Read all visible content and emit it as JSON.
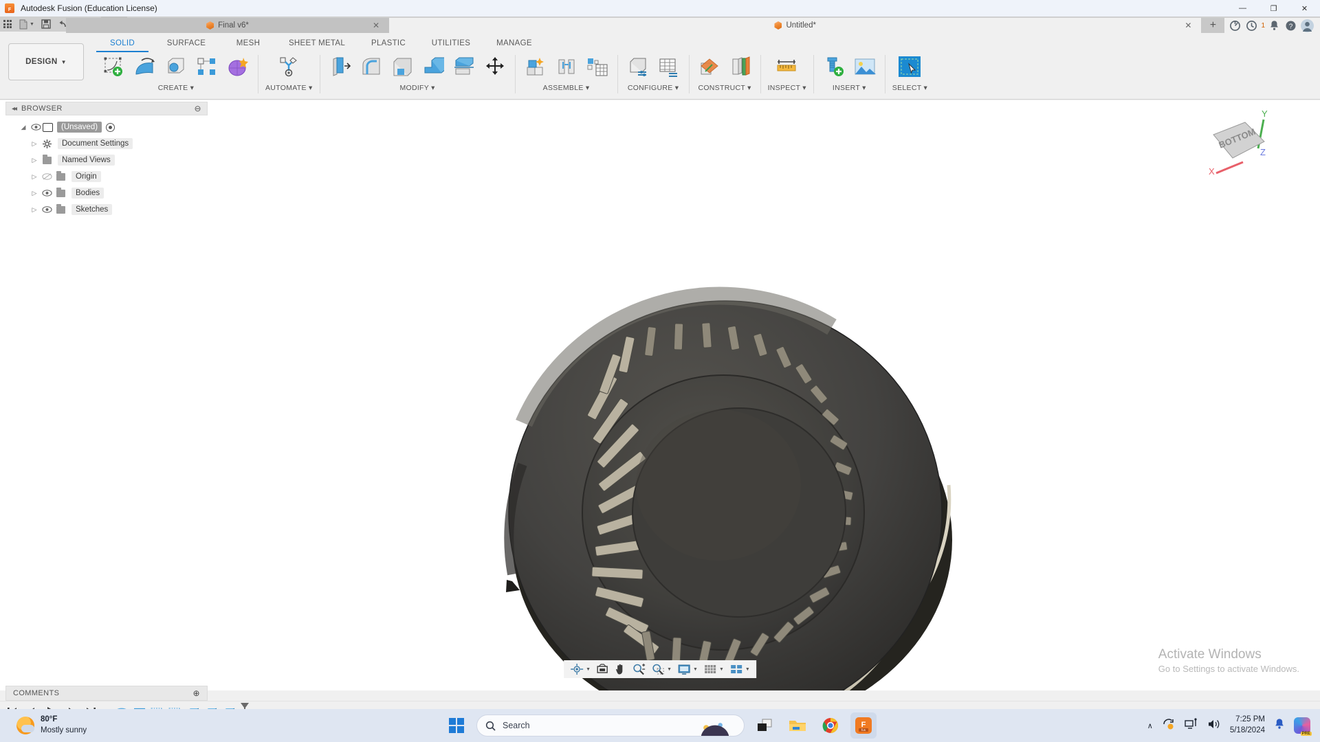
{
  "window": {
    "title": "Autodesk Fusion (Education License)",
    "app_icon": "fusion-logo-icon",
    "minimize": "—",
    "maximize": "❐",
    "close": "✕"
  },
  "quick_access": {
    "items": [
      {
        "name": "app-grid-button",
        "icon": "grid-icon",
        "caret": false
      },
      {
        "name": "new-document-button",
        "icon": "file-icon",
        "caret": true
      },
      {
        "name": "save-button",
        "icon": "save-icon",
        "caret": false
      },
      {
        "name": "undo-button",
        "icon": "undo-arrow-icon",
        "caret": true
      },
      {
        "name": "redo-button",
        "icon": "redo-arrow-icon",
        "caret": true
      },
      {
        "name": "home-button",
        "icon": "home-icon",
        "caret": false
      }
    ]
  },
  "tabs": {
    "documents": [
      {
        "label": "Final v6*",
        "active": true,
        "closable": true
      },
      {
        "label": "Untitled*",
        "active": false,
        "closable": true
      }
    ],
    "close_glyph": "✕",
    "new_tab_glyph": "+",
    "actions": [
      {
        "name": "extensions-icon",
        "label": ""
      },
      {
        "name": "job-status-icon",
        "label": "1"
      },
      {
        "name": "notifications-bell-icon",
        "label": ""
      },
      {
        "name": "help-question-icon",
        "label": ""
      },
      {
        "name": "user-avatar",
        "label": ""
      }
    ],
    "job_count": "1"
  },
  "ribbon": {
    "workspace": "DESIGN",
    "workspace_caret": "▾",
    "tabs": [
      {
        "label": "SOLID",
        "active": true
      },
      {
        "label": "SURFACE",
        "active": false
      },
      {
        "label": "MESH",
        "active": false
      },
      {
        "label": "SHEET METAL",
        "active": false
      },
      {
        "label": "PLASTIC",
        "active": false
      },
      {
        "label": "UTILITIES",
        "active": false
      },
      {
        "label": "MANAGE",
        "active": false
      }
    ],
    "panels": [
      {
        "label": "CREATE ▾",
        "tools": [
          "new-sketch-icon",
          "revolve-icon",
          "loft-icon",
          "pattern-icon",
          "form-icon"
        ]
      },
      {
        "label": "AUTOMATE ▾",
        "tools": [
          "automate-icon"
        ]
      },
      {
        "label": "MODIFY ▾",
        "tools": [
          "press-pull-icon",
          "fillet-icon",
          "shell-icon",
          "combine-icon",
          "split-body-icon",
          "move-copy-icon"
        ]
      },
      {
        "label": "ASSEMBLE ▾",
        "tools": [
          "new-component-icon",
          "joint-icon",
          "assemble-table-icon"
        ]
      },
      {
        "label": "CONFIGURE ▾",
        "tools": [
          "configure-component-icon",
          "configure-table-icon"
        ]
      },
      {
        "label": "CONSTRUCT ▾",
        "tools": [
          "offset-plane-icon",
          "plane-at-angle-icon"
        ]
      },
      {
        "label": "INSPECT ▾",
        "tools": [
          "measure-icon"
        ]
      },
      {
        "label": "INSERT ▾",
        "tools": [
          "insert-mcmaster-icon",
          "insert-canvas-icon"
        ]
      },
      {
        "label": "SELECT ▾",
        "tools": [
          "select-window-icon"
        ]
      }
    ]
  },
  "browser": {
    "title": "BROWSER",
    "collapse_glyph": "◂◂",
    "minimize_glyph": "⊖",
    "nodes": [
      {
        "label": "(Unsaved)",
        "icon": "document-cube-icon",
        "visibility": "eye-visible-icon",
        "selected": true,
        "expander": "expanded-arrow",
        "has_radio": true
      },
      {
        "label": "Document Settings",
        "icon": "gear-icon",
        "visibility": "none",
        "selected": false,
        "expander": "collapsed-arrow",
        "has_radio": false
      },
      {
        "label": "Named Views",
        "icon": "folder-icon",
        "visibility": "none",
        "selected": false,
        "expander": "collapsed-arrow",
        "has_radio": false
      },
      {
        "label": "Origin",
        "icon": "folder-icon",
        "visibility": "eye-hidden-icon",
        "selected": false,
        "expander": "collapsed-arrow",
        "has_radio": false
      },
      {
        "label": "Bodies",
        "icon": "folder-icon",
        "visibility": "eye-visible-icon",
        "selected": false,
        "expander": "collapsed-arrow",
        "has_radio": false
      },
      {
        "label": "Sketches",
        "icon": "folder-icon",
        "visibility": "eye-visible-icon",
        "selected": false,
        "expander": "collapsed-arrow",
        "has_radio": false
      }
    ]
  },
  "viewcube": {
    "face_label": "BOTTOM",
    "axes": [
      {
        "label": "X",
        "color": "#e8606a"
      },
      {
        "label": "Y",
        "color": "#4caf50"
      },
      {
        "label": "Z",
        "color": "#6a7adf"
      }
    ]
  },
  "model": {
    "description": "dark grey cylindrical coil-threaded part shown from bottom view",
    "body_color": "#3a3937",
    "highlight_color": "#d8d2c0"
  },
  "navbar": {
    "items": [
      {
        "name": "orbit-button",
        "icon": "orbit-icon",
        "caret": true
      },
      {
        "name": "look-at-button",
        "icon": "look-at-icon",
        "caret": false
      },
      {
        "name": "pan-button",
        "icon": "pan-hand-icon",
        "caret": false
      },
      {
        "name": "zoom-button",
        "icon": "zoom-magnifier-icon",
        "caret": false
      },
      {
        "name": "fit-button",
        "icon": "zoom-window-icon",
        "caret": true
      },
      {
        "name": "display-settings-button",
        "icon": "monitor-icon",
        "caret": true
      },
      {
        "name": "grid-snaps-button",
        "icon": "grid-table-icon",
        "caret": true
      },
      {
        "name": "viewports-button",
        "icon": "viewports-icon",
        "caret": true
      }
    ]
  },
  "watermark": {
    "title": "Activate Windows",
    "subtitle": "Go to Settings to activate Windows."
  },
  "comments": {
    "title": "COMMENTS",
    "add_glyph": "⊕"
  },
  "timeline": {
    "controls": [
      {
        "name": "go-to-beginning-button",
        "glyph": "⏮"
      },
      {
        "name": "step-back-button",
        "glyph": "◀"
      },
      {
        "name": "play-button",
        "glyph": "▶"
      },
      {
        "name": "step-forward-button",
        "glyph": "▶"
      },
      {
        "name": "go-to-end-button",
        "glyph": "⏭"
      }
    ],
    "features": [
      {
        "name": "timeline-feature-cylinder",
        "icon": "cylinder-icon"
      },
      {
        "name": "timeline-feature-coil",
        "icon": "coil-icon"
      },
      {
        "name": "timeline-feature-sketch-1",
        "icon": "sketch-icon"
      },
      {
        "name": "timeline-feature-sketch-2",
        "icon": "sketch-icon"
      },
      {
        "name": "timeline-feature-extrude-1",
        "icon": "extrude-icon"
      },
      {
        "name": "timeline-feature-extrude-2",
        "icon": "extrude-icon"
      },
      {
        "name": "timeline-feature-extrude-3",
        "icon": "extrude-icon"
      }
    ],
    "marker": "timeline-end-marker"
  },
  "taskbar": {
    "weather": {
      "temperature": "80°F",
      "condition": "Mostly sunny",
      "icon": "sun-cloud-icon"
    },
    "start": {
      "name": "start-button",
      "icon": "windows-logo-icon"
    },
    "search": {
      "placeholder": "Search",
      "icon": "search-icon"
    },
    "apps": [
      {
        "name": "task-view-button",
        "icon": "task-view-icon",
        "active": false
      },
      {
        "name": "file-explorer-button",
        "icon": "folder-icon",
        "active": false
      },
      {
        "name": "chrome-button",
        "icon": "chrome-icon",
        "active": false
      },
      {
        "name": "fusion-taskbar-button",
        "icon": "fusion-logo-icon",
        "active": true
      }
    ],
    "tray": {
      "chevron": "∧",
      "icons": [
        "update-sync-icon",
        "network-icon",
        "volume-icon"
      ],
      "time": "7:25 PM",
      "date": "5/18/2024",
      "bell": "notification-bell-icon",
      "copilot": "copilot-icon"
    }
  }
}
